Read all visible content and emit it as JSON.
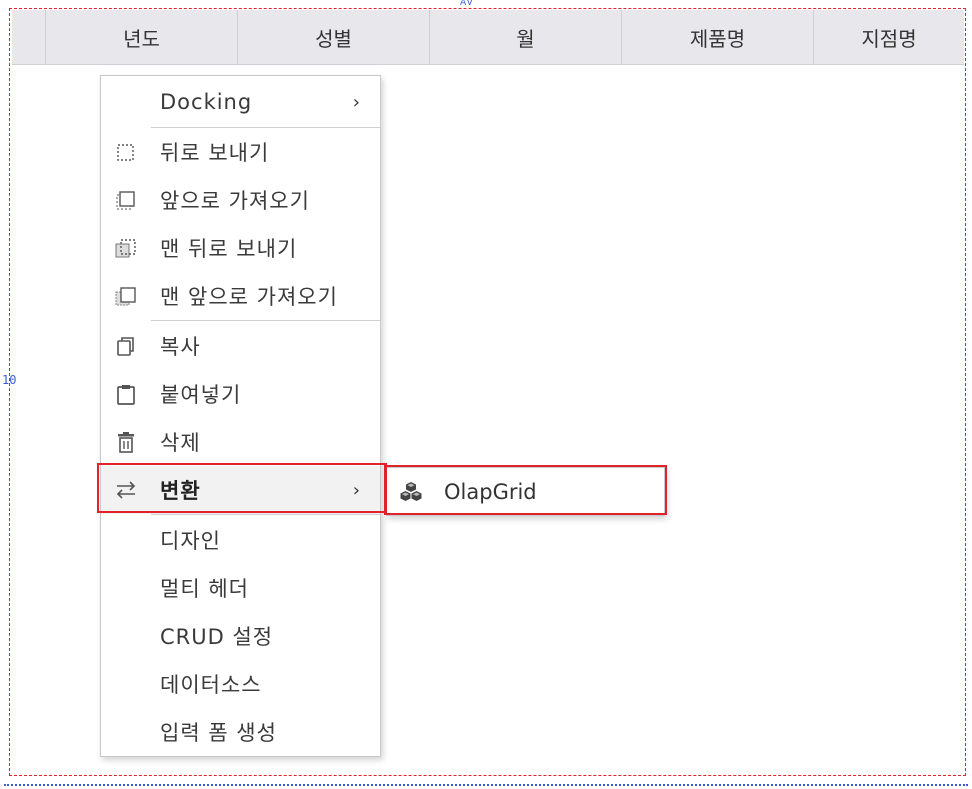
{
  "canvas_anchor_top": "AV",
  "canvas_anchor_left": "10",
  "grid": {
    "columns": [
      "년도",
      "성별",
      "월",
      "제품명",
      "지점명"
    ]
  },
  "context_menu": {
    "docking_label": "Docking",
    "send_backward_label": "뒤로 보내기",
    "bring_forward_label": "앞으로 가져오기",
    "send_to_back_label": "맨 뒤로 보내기",
    "bring_to_front_label": "맨 앞으로 가져오기",
    "copy_label": "복사",
    "paste_label": "붙여넣기",
    "delete_label": "삭제",
    "convert_label": "변환",
    "design_label": "디자인",
    "multi_header_label": "멀티 헤더",
    "crud_label": "CRUD 설정",
    "datasource_label": "데이터소스",
    "input_form_label": "입력 폼 생성",
    "submenu_arrow": "›"
  },
  "submenu": {
    "olapgrid_label": "OlapGrid"
  },
  "colors": {
    "highlight": "#e0222b",
    "selection_blue": "#3a5cd6"
  },
  "icons": {
    "send_backward": "send-backward-icon",
    "bring_forward": "bring-forward-icon",
    "send_to_back": "send-to-back-icon",
    "bring_to_front": "bring-to-front-icon",
    "copy": "copy-icon",
    "paste": "clipboard-icon",
    "delete": "trash-icon",
    "convert": "swap-arrows-icon",
    "olapgrid": "cubes-icon"
  }
}
